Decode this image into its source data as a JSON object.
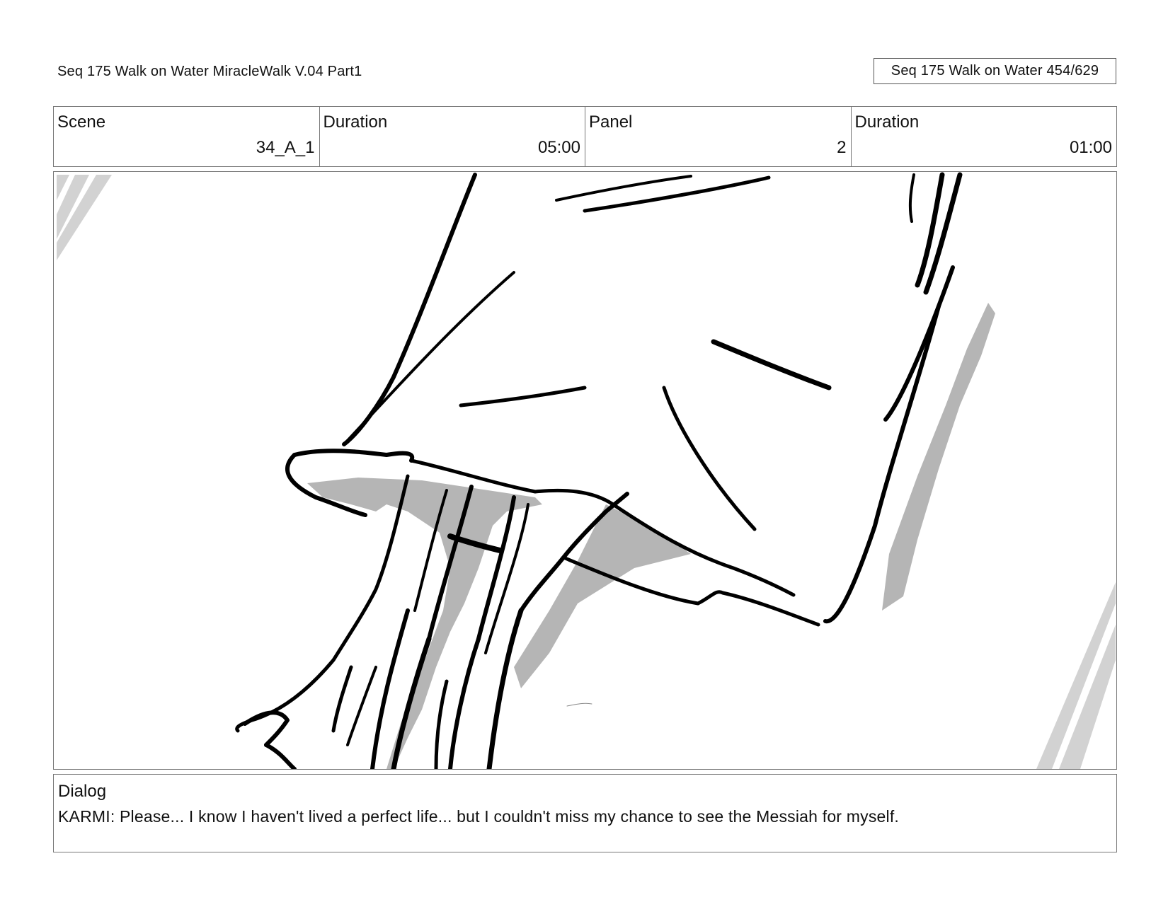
{
  "header": {
    "title": "Seq 175 Walk on Water  MiracleWalk V.04 Part1",
    "page_box": "Seq 175 Walk on Water 454/629"
  },
  "info": {
    "scene_label": "Scene",
    "scene_value": "34_A_1",
    "scene_duration_label": "Duration",
    "scene_duration_value": "05:00",
    "panel_label": "Panel",
    "panel_value": "2",
    "panel_duration_label": "Duration",
    "panel_duration_value": "01:00"
  },
  "panel_image": {
    "icon": "storyboard-sketch-robe-and-feet",
    "colors": {
      "ink": "#000000",
      "shadow": "#b5b5b5",
      "glare": "#d0d0d0"
    }
  },
  "dialog": {
    "label": "Dialog",
    "text": "KARMI: Please... I know I haven't lived a perfect life... but I couldn't miss my chance to see the Messiah for myself."
  }
}
